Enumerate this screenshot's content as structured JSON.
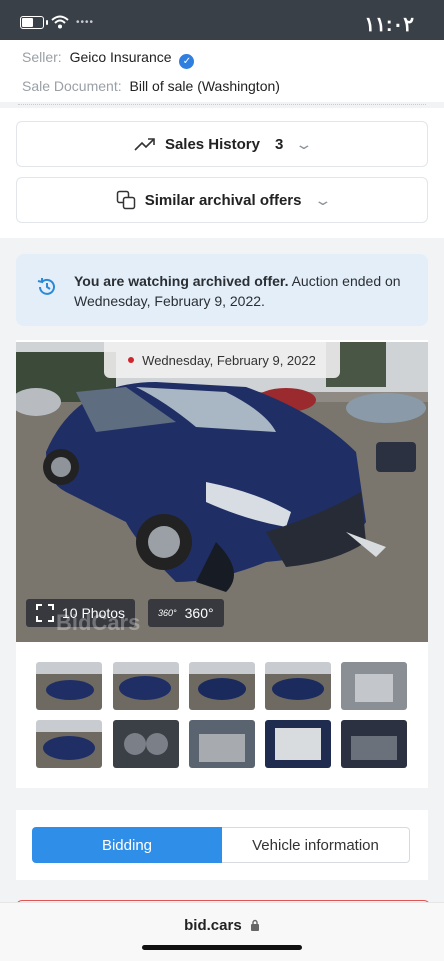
{
  "status": {
    "time": "١١:٠٢",
    "battery_level": 0.6,
    "signal_dots": "••••"
  },
  "details": {
    "seller_label": "Seller:",
    "seller_value": "Geico Insurance",
    "doc_label": "Sale Document:",
    "doc_value": "Bill of sale (Washington)"
  },
  "sales_history": {
    "label": "Sales History",
    "count": "3"
  },
  "similar": {
    "label": "Similar archival offers"
  },
  "notice": {
    "bold": "You are watching archived offer.",
    "text": " Auction ended on Wednesday, February 9, 2022."
  },
  "gallery": {
    "date": "Wednesday, February 9, 2022",
    "photos_label": "10 Photos",
    "view360_label": "360°",
    "badge_360": "360°",
    "watermark": "BidCars"
  },
  "tabs": {
    "bidding": "Bidding",
    "vehicle_info": "Vehicle information"
  },
  "browser": {
    "url": "bid.cars"
  },
  "colors": {
    "accent": "#2f8ee8",
    "notice_bg": "#e3eef9",
    "status_bar": "#3a4048"
  }
}
